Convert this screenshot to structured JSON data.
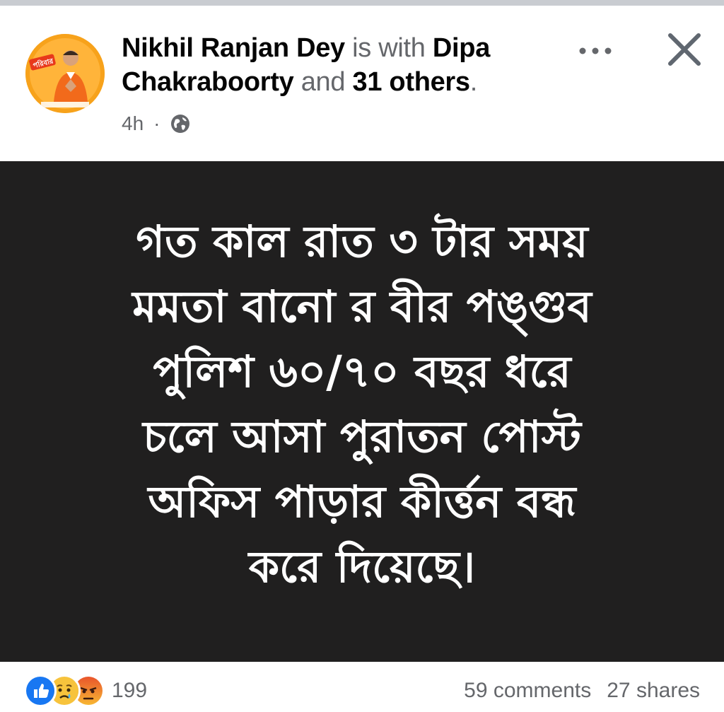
{
  "post": {
    "author": "Nikhil Ranjan Dey",
    "with_text": " is with ",
    "tagged_primary": "Dipa Chakraboorty",
    "and_text": " and ",
    "tagged_others": "31 others",
    "period": ".",
    "time": "4h",
    "separator": "·",
    "privacy_icon": "globe-icon",
    "avatar_badge": "পরিবার",
    "image_text": "গত কাল রাত ৩ টার সময়\nমমতা বানো র বীর পঙ্গুব\nপুলিশ ৬০/৭০ বছর ধরে\nচলে আসা পুরাতন পোস্ট\nঅফিস পাড়ার কীর্ত্তন বন্ধ\nকরে দিয়েছে।"
  },
  "header_actions": {
    "more_icon": "more-dots-icon",
    "close_icon": "close-icon"
  },
  "footer": {
    "reaction_icons": [
      "like-icon",
      "sad-icon",
      "angry-icon"
    ],
    "reaction_count": "199",
    "comments": "59 comments",
    "shares": "27 shares"
  },
  "colors": {
    "image_background": "#201f1f",
    "like_blue": "#1877f2",
    "avatar_orange": "#f7a21b",
    "secondary_text": "#65676b"
  }
}
